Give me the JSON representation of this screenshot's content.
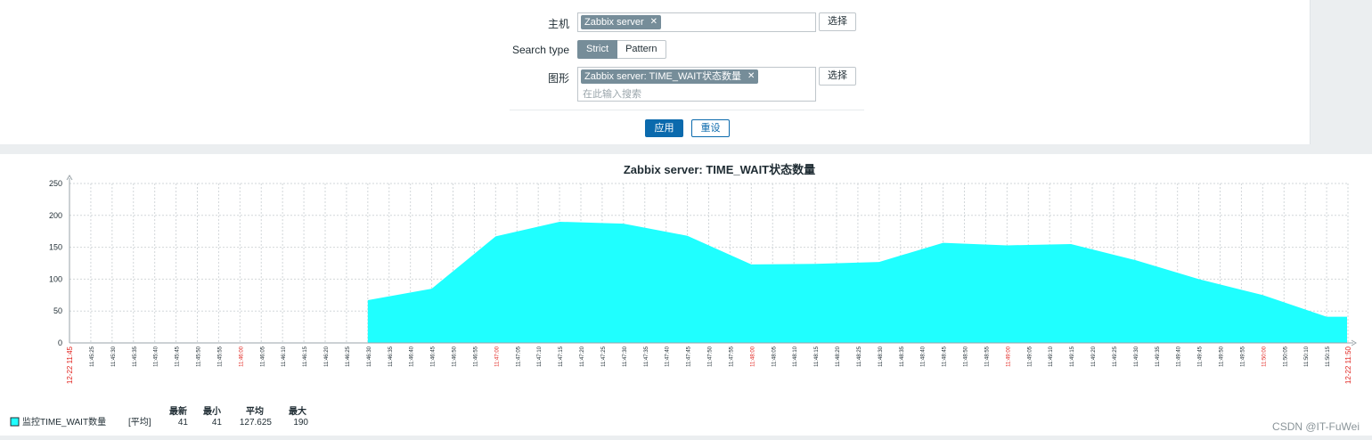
{
  "filter": {
    "host_label": "主机",
    "host_chip": "Zabbix server",
    "select_label": "选择",
    "search_type_label": "Search type",
    "search_type_options": [
      "Strict",
      "Pattern"
    ],
    "graph_label": "图形",
    "graph_chip": "Zabbix server: TIME_WAIT状态数量",
    "graph_placeholder": "在此输入搜索",
    "apply_label": "应用",
    "reset_label": "重设",
    "chip_remove": "✕"
  },
  "graph": {
    "fill_color": "#1fffff",
    "grid_color": "#d2d7da",
    "legend": {
      "headers": [
        "最新",
        "最小",
        "平均",
        "最大"
      ],
      "series_name": "监控TIME_WAIT数量",
      "func": "[平均]",
      "values": [
        "41",
        "41",
        "127.625",
        "190"
      ]
    }
  },
  "chart_data": {
    "type": "area",
    "title": "Zabbix server: TIME_WAIT状态数量",
    "ylim": [
      0,
      250
    ],
    "y_ticks": [
      "0",
      "50",
      "100",
      "150",
      "200",
      "250"
    ],
    "x_ticks": [
      "12-22 11:45",
      "11:45:25",
      "11:45:30",
      "11:45:35",
      "11:45:40",
      "11:45:45",
      "11:45:50",
      "11:45:55",
      "11:46:00",
      "11:46:05",
      "11:46:10",
      "11:46:15",
      "11:46:20",
      "11:46:25",
      "11:46:30",
      "11:46:35",
      "11:46:40",
      "11:46:45",
      "11:46:50",
      "11:46:55",
      "11:47:00",
      "11:47:05",
      "11:47:10",
      "11:47:15",
      "11:47:20",
      "11:47:25",
      "11:47:30",
      "11:47:35",
      "11:47:40",
      "11:47:45",
      "11:47:50",
      "11:47:55",
      "11:48:00",
      "11:48:05",
      "11:48:10",
      "11:48:15",
      "11:48:20",
      "11:48:25",
      "11:48:30",
      "11:48:35",
      "11:48:40",
      "11:48:45",
      "11:48:50",
      "11:48:55",
      "11:49:00",
      "11:49:05",
      "11:49:10",
      "11:49:15",
      "11:49:20",
      "11:49:25",
      "11:49:30",
      "11:49:35",
      "11:49:40",
      "11:49:45",
      "11:49:50",
      "11:49:55",
      "11:50:00",
      "11:50:05",
      "11:50:10",
      "11:50:15",
      "12-22 11:50"
    ],
    "x_ticks_red": [
      "12-22 11:45",
      "11:46:00",
      "11:47:00",
      "11:48:00",
      "11:49:00",
      "11:50:00",
      "12-22 11:50"
    ],
    "grid": true,
    "series": [
      {
        "name": "监控TIME_WAIT数量",
        "x": [
          "11:46:30",
          "11:46:45",
          "11:47:00",
          "11:47:15",
          "11:47:30",
          "11:47:45",
          "11:48:00",
          "11:48:15",
          "11:48:30",
          "11:48:45",
          "11:49:00",
          "11:49:15",
          "11:49:30",
          "11:49:45",
          "11:50:00",
          "11:50:15",
          "11:50:20"
        ],
        "values": [
          67,
          85,
          167,
          190,
          187,
          168,
          123,
          124,
          127,
          157,
          153,
          155,
          130,
          100,
          75,
          41,
          41
        ]
      }
    ]
  },
  "watermark": "CSDN @IT-FuWei"
}
